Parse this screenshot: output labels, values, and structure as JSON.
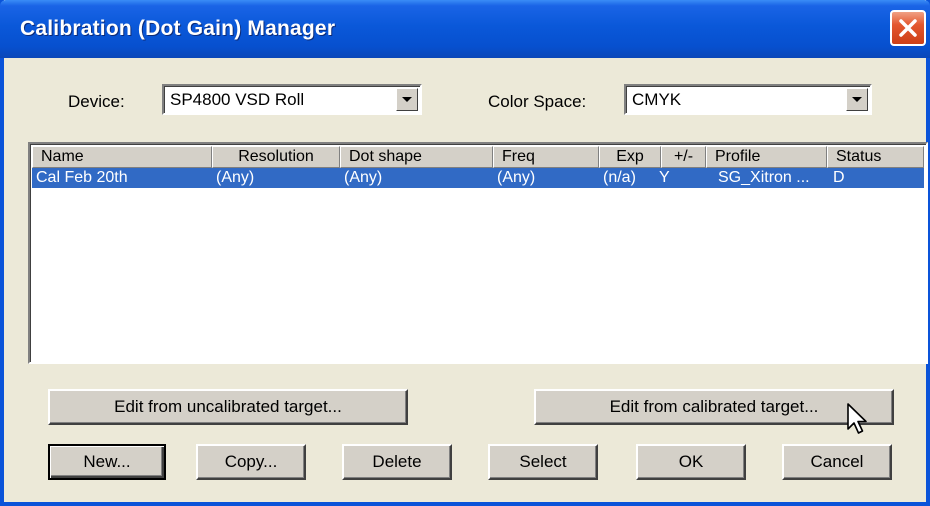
{
  "window": {
    "title": "Calibration (Dot Gain) Manager"
  },
  "device": {
    "label": "Device:",
    "value": "SP4800 VSD Roll"
  },
  "color_space": {
    "label": "Color Space:",
    "value": "CMYK"
  },
  "list": {
    "columns": [
      "Name",
      "Resolution",
      "Dot shape",
      "Freq",
      "Exp",
      "+/-",
      "Profile",
      "Status"
    ],
    "rows": [
      {
        "selected": true,
        "cells": [
          "Cal Feb 20th",
          "(Any)",
          "(Any)",
          "(Any)",
          "(n/a)",
          "Y",
          "SG_Xitron ...",
          "D"
        ]
      }
    ]
  },
  "buttons": {
    "edit_uncalibrated": "Edit from uncalibrated target...",
    "edit_calibrated": "Edit from calibrated target...",
    "new": "New...",
    "copy": "Copy...",
    "delete": "Delete",
    "select": "Select",
    "ok": "OK",
    "cancel": "Cancel"
  },
  "icons": {
    "close": "close-icon",
    "dropdown": "chevron-down-icon",
    "cursor": "mouse-pointer-icon"
  },
  "colors": {
    "title_bar": "#0a58d9",
    "selection": "#316ac5",
    "dialog_face": "#ece9d8",
    "close_button": "#e4572e"
  }
}
